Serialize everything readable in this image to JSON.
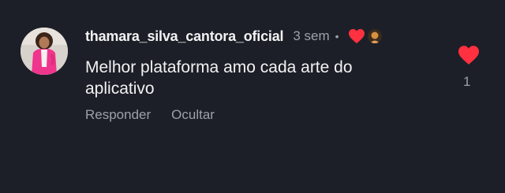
{
  "comment": {
    "username": "thamara_silva_cantora_oficial",
    "time": "3 sem",
    "separator": "•",
    "text": "Melhor plataforma amo cada arte do aplicativo",
    "actions": {
      "reply": "Responder",
      "hide": "Ocultar"
    },
    "like_count": "1",
    "liked": true,
    "liked_by_creator": true
  },
  "icons": {
    "like": "heart-icon",
    "creator_like": "heart-icon",
    "creator_avatar": "avatar"
  },
  "colors": {
    "background": "#1c1f28",
    "heart": "#ff3040",
    "muted_text": "#9da0a8",
    "text": "#f2f2f2"
  }
}
